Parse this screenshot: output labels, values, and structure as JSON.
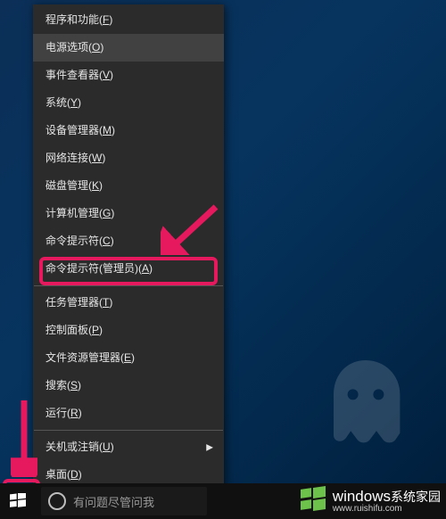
{
  "menu": {
    "items": [
      {
        "label": "程序和功能",
        "hotkey": "F",
        "hover": false,
        "submenu": false
      },
      {
        "label": "电源选项",
        "hotkey": "O",
        "hover": true,
        "submenu": false
      },
      {
        "label": "事件查看器",
        "hotkey": "V",
        "hover": false,
        "submenu": false
      },
      {
        "label": "系统",
        "hotkey": "Y",
        "hover": false,
        "submenu": false
      },
      {
        "label": "设备管理器",
        "hotkey": "M",
        "hover": false,
        "submenu": false
      },
      {
        "label": "网络连接",
        "hotkey": "W",
        "hover": false,
        "submenu": false
      },
      {
        "label": "磁盘管理",
        "hotkey": "K",
        "hover": false,
        "submenu": false
      },
      {
        "label": "计算机管理",
        "hotkey": "G",
        "hover": false,
        "submenu": false
      },
      {
        "label": "命令提示符",
        "hotkey": "C",
        "hover": false,
        "submenu": false
      },
      {
        "label": "命令提示符(管理员)",
        "hotkey": "A",
        "hover": false,
        "submenu": false,
        "highlighted": true
      },
      {
        "sep": true
      },
      {
        "label": "任务管理器",
        "hotkey": "T",
        "hover": false,
        "submenu": false
      },
      {
        "label": "控制面板",
        "hotkey": "P",
        "hover": false,
        "submenu": false
      },
      {
        "label": "文件资源管理器",
        "hotkey": "E",
        "hover": false,
        "submenu": false
      },
      {
        "label": "搜索",
        "hotkey": "S",
        "hover": false,
        "submenu": false
      },
      {
        "label": "运行",
        "hotkey": "R",
        "hover": false,
        "submenu": false
      },
      {
        "sep": true
      },
      {
        "label": "关机或注销",
        "hotkey": "U",
        "hover": false,
        "submenu": true
      },
      {
        "label": "桌面",
        "hotkey": "D",
        "hover": false,
        "submenu": false
      }
    ]
  },
  "taskbar": {
    "search_placeholder": "有问题尽管问我"
  },
  "watermark": {
    "brand_main": "windows",
    "brand_sub": "系统家园",
    "brand_url": "www.ruishifu.com"
  },
  "colors": {
    "annotation": "#e6185e",
    "menu_bg": "#2b2b2b",
    "menu_hover": "#414141",
    "logo_green": "#6cc24a"
  }
}
